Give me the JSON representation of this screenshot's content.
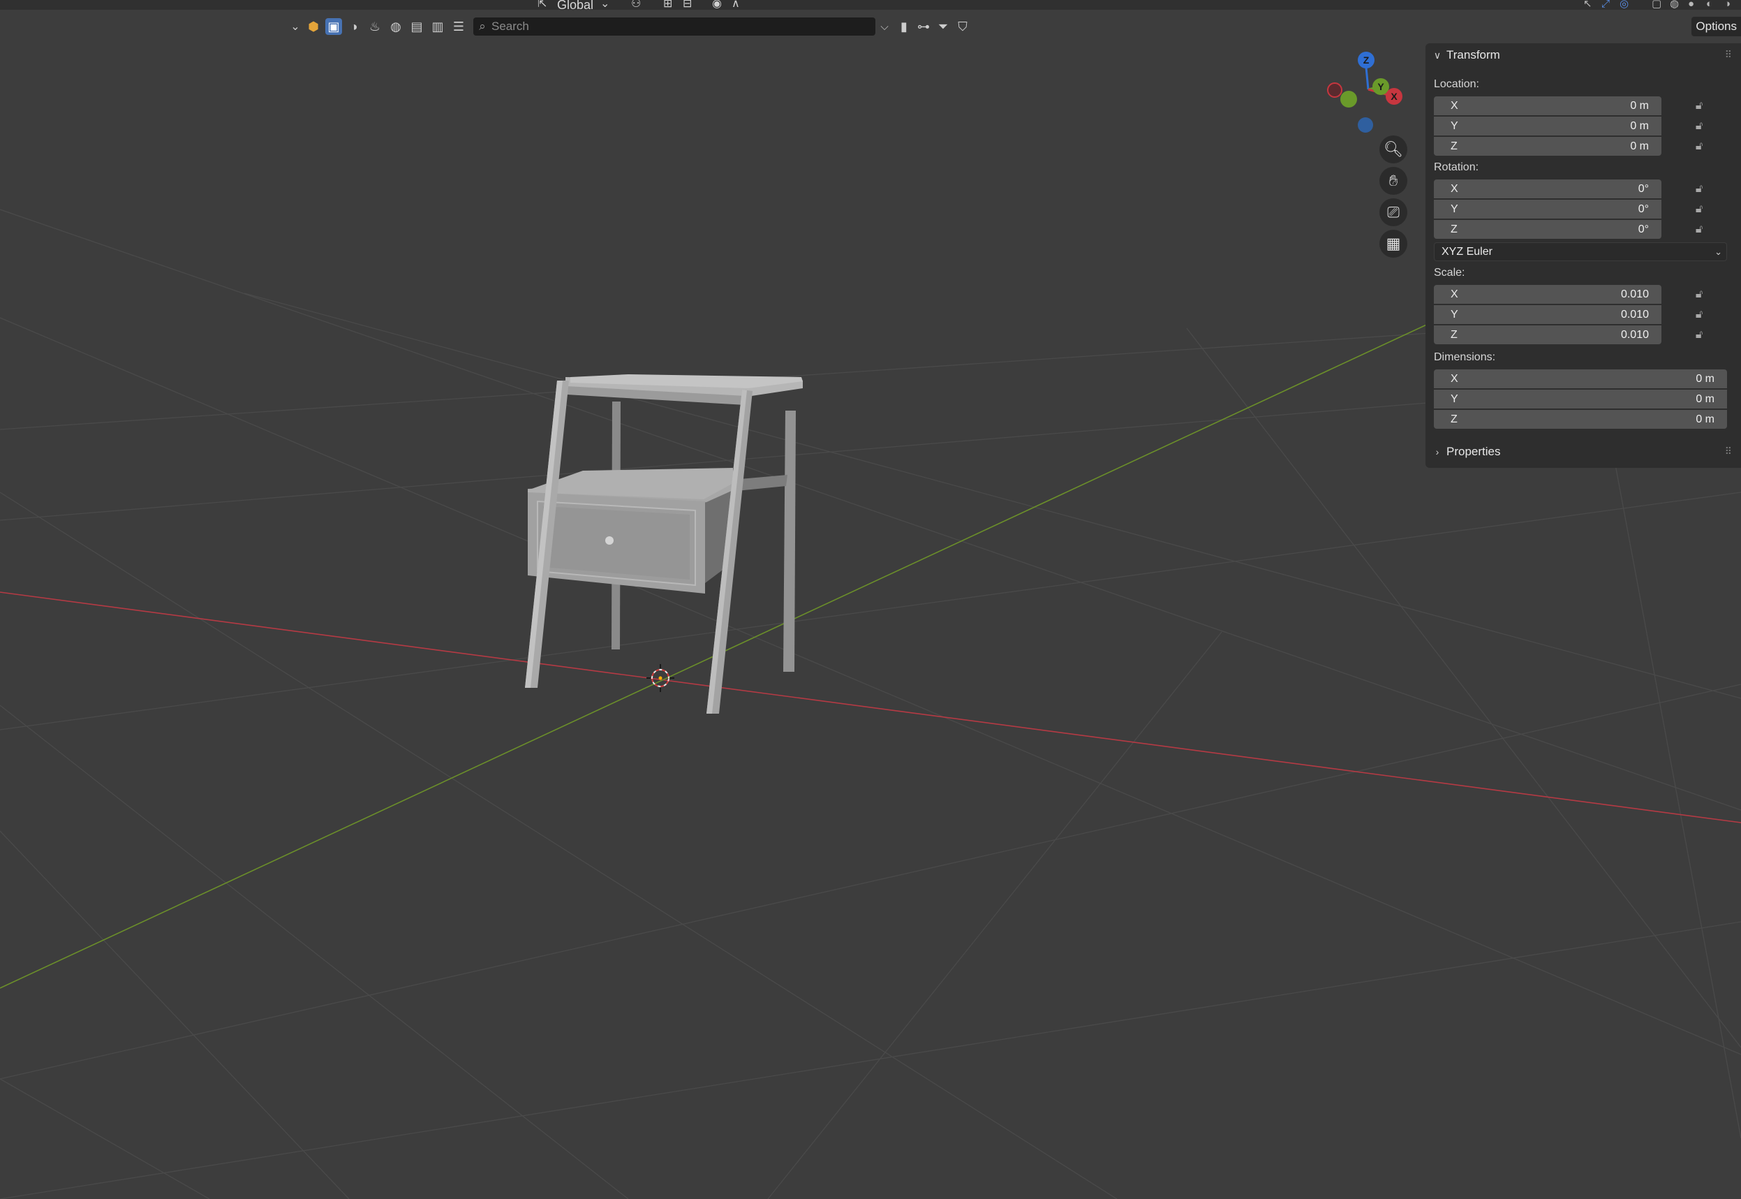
{
  "header": {
    "orientation_label": "Global"
  },
  "search": {
    "placeholder": "Search"
  },
  "options_label": "Options",
  "gizmo": {
    "z_label": "Z",
    "y_label": "Y",
    "x_label": "X"
  },
  "transform_panel": {
    "title": "Transform",
    "location": {
      "label": "Location:",
      "fields": [
        {
          "axis": "X",
          "value": "0 m"
        },
        {
          "axis": "Y",
          "value": "0 m"
        },
        {
          "axis": "Z",
          "value": "0 m"
        }
      ]
    },
    "rotation": {
      "label": "Rotation:",
      "fields": [
        {
          "axis": "X",
          "value": "0°"
        },
        {
          "axis": "Y",
          "value": "0°"
        },
        {
          "axis": "Z",
          "value": "0°"
        }
      ],
      "mode": "XYZ Euler"
    },
    "scale": {
      "label": "Scale:",
      "fields": [
        {
          "axis": "X",
          "value": "0.010"
        },
        {
          "axis": "Y",
          "value": "0.010"
        },
        {
          "axis": "Z",
          "value": "0.010"
        }
      ]
    },
    "dimensions": {
      "label": "Dimensions:",
      "fields": [
        {
          "axis": "X",
          "value": "0 m"
        },
        {
          "axis": "Y",
          "value": "0 m"
        },
        {
          "axis": "Z",
          "value": "0 m"
        }
      ]
    }
  },
  "properties_panel": {
    "title": "Properties"
  },
  "colors": {
    "axis_x": "#c7363f",
    "axis_y": "#6a9a2a",
    "axis_z": "#2f6fd4",
    "active_tool": "#4772b3"
  }
}
